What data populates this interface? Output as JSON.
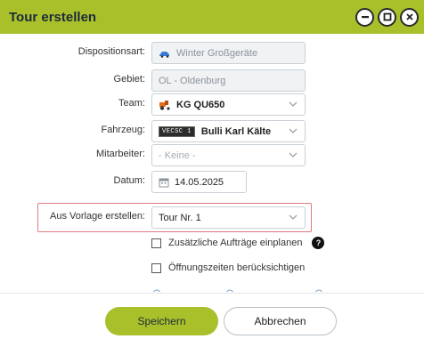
{
  "dialog": {
    "title": "Tour erstellen"
  },
  "window_controls": {
    "minimize_icon": "minus-icon",
    "maximize_icon": "square-icon",
    "close_icon": "close-icon"
  },
  "form": {
    "dispositionsart": {
      "label": "Dispositionsart:",
      "value": "Winter Großgeräte",
      "icon": "vehicle-icon"
    },
    "gebiet": {
      "label": "Gebiet:",
      "value": "OL - Oldenburg"
    },
    "team": {
      "label": "Team:",
      "value": "KG QU650",
      "icon": "tractor-icon"
    },
    "fahrzeug": {
      "label": "Fahrzeug:",
      "tag": "VECSC 1",
      "value": "Bulli Karl Kälte"
    },
    "mitarbeiter": {
      "label": "Mitarbeiter:",
      "placeholder": "- Keine -"
    },
    "datum": {
      "label": "Datum:",
      "value": "14.05.2025",
      "icon": "calendar-icon"
    },
    "vorlage": {
      "label": "Aus Vorlage erstellen:",
      "value": "Tour Nr. 1"
    }
  },
  "checks": {
    "zusaetzliche": {
      "label": "Zusätzliche Aufträge einplanen",
      "checked": false
    },
    "oeffnungszeiten": {
      "label": "Öffnungszeiten berücksichtigen",
      "checked": false
    }
  },
  "footer": {
    "save_label": "Speichern",
    "cancel_label": "Abbrechen"
  },
  "colors": {
    "accent": "#a9c02a",
    "highlight_border": "#e07a80"
  }
}
